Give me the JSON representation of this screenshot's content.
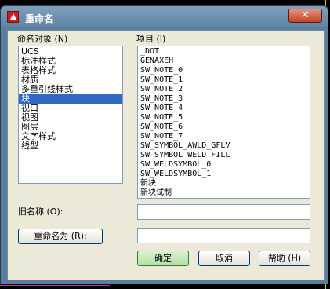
{
  "window": {
    "title": "重命名",
    "close_glyph": "✕"
  },
  "named_objects": {
    "label": "命名对象 (N)",
    "items": [
      "UCS",
      "标注样式",
      "表格样式",
      "材质",
      "多重引线样式",
      "块",
      "视口",
      "视图",
      "图层",
      "文字样式",
      "线型"
    ],
    "selected_index": 5
  },
  "items_list": {
    "label": "项目 (I)",
    "items": [
      "_DOT",
      "GENAXEH",
      "SW_NOTE_0",
      "SW_NOTE_1",
      "SW_NOTE_2",
      "SW_NOTE_3",
      "SW_NOTE_4",
      "SW_NOTE_5",
      "SW_NOTE_6",
      "SW_NOTE_7",
      "SW_SYMBOL_AWLD_GFLV",
      "SW_SYMBOL_WELD_FILL",
      "SW_WELDSYMBOL_0",
      "SW_WELDSYMBOL_1",
      "新块",
      "新块试制"
    ]
  },
  "old_name": {
    "label": "旧名称 (O):",
    "value": ""
  },
  "rename_to": {
    "button_label": "重命名为 (R):",
    "value": ""
  },
  "buttons": {
    "ok": "确定",
    "cancel": "取消",
    "help": "帮助 (H)"
  },
  "colors": {
    "title_bar": "#5f83a3",
    "selection": "#316ac5",
    "ok_button": "#b3e0a3"
  }
}
